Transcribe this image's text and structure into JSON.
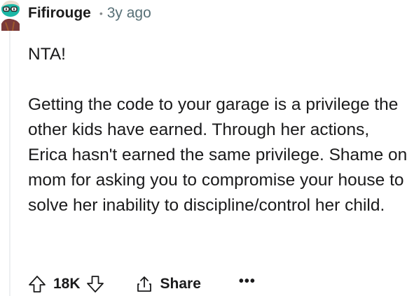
{
  "comment": {
    "author": "Fifirouge",
    "separator": "•",
    "age": "3y ago",
    "body": [
      "NTA!",
      "Getting the code to your garage is a privilege the other kids have earned. Through her actions, Erica hasn't earned the same privilege. Shame on mom for asking you to compromise your house to solve her inability to discipline/control her child."
    ],
    "actions": {
      "vote_count": "18K",
      "share_label": "Share",
      "more_label": "•••"
    }
  },
  "icons": {
    "avatar": "snoo-avatar-icon",
    "upvote": "upvote-arrow-icon",
    "downvote": "downvote-arrow-icon",
    "share": "share-icon",
    "more": "overflow-menu-icon"
  },
  "colors": {
    "avatar_face": "#1bb8a6",
    "avatar_body": "#7a3a3a",
    "meta_text": "#576f76",
    "thread_line": "#edeff1"
  }
}
